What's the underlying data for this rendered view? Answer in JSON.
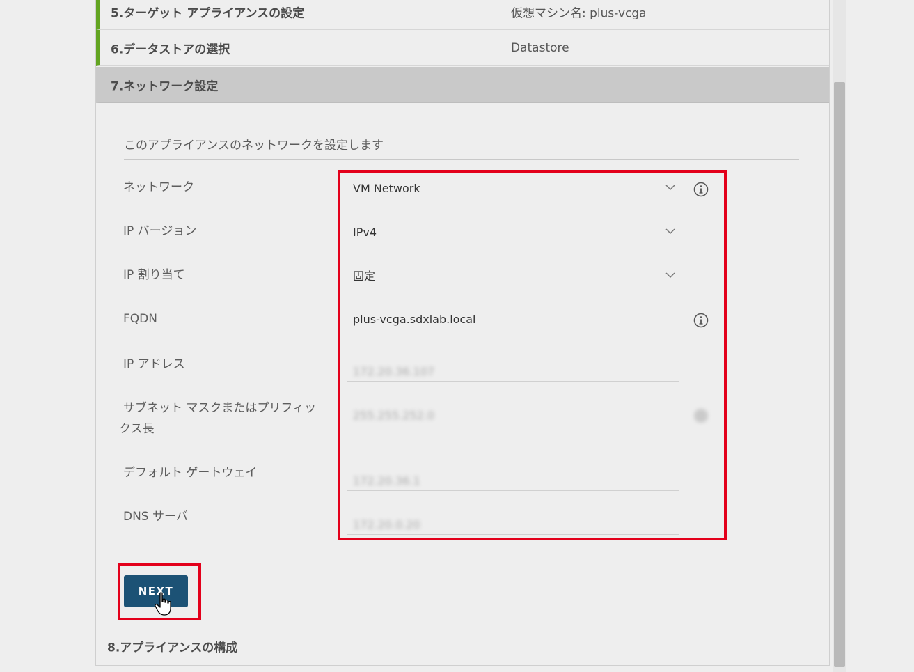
{
  "steps": [
    {
      "title": "5.ターゲット アプライアンスの設定",
      "value": "仮想マシン名: plus-vcga"
    },
    {
      "title": "6.データストアの選択",
      "value": "Datastore"
    },
    {
      "title": "7.ネットワーク設定"
    },
    {
      "title": "8.アプライアンスの構成"
    }
  ],
  "form": {
    "description": "このアプライアンスのネットワークを設定します",
    "network": {
      "label": "ネットワーク",
      "value": "VM Network",
      "icon": "chevron-down-icon",
      "info_icon": "info-icon"
    },
    "ip_version": {
      "label": "IP バージョン",
      "value": "IPv4",
      "icon": "chevron-down-icon"
    },
    "ip_assignment": {
      "label": "IP 割り当て",
      "value": "固定",
      "icon": "chevron-down-icon"
    },
    "fqdn": {
      "label": "FQDN",
      "value": "plus-vcga.sdxlab.local",
      "info_icon": "info-icon"
    },
    "ip_address": {
      "label": "IP アドレス",
      "value": "172.20.36.107"
    },
    "subnet": {
      "label": "サブネット マスクまたはプリフィックス長",
      "value": "255.255.252.0"
    },
    "gateway": {
      "label": "デフォルト ゲートウェイ",
      "value": "172.20.36.1"
    },
    "dns": {
      "label": "DNS サーバ",
      "value": "172.20.0.20"
    }
  },
  "buttons": {
    "next": "NEXT"
  },
  "colors": {
    "accent_done": "#62a420",
    "active_step_bg": "#c9c9c9",
    "next_button": "#1c5275",
    "highlight": "#e3001b"
  }
}
